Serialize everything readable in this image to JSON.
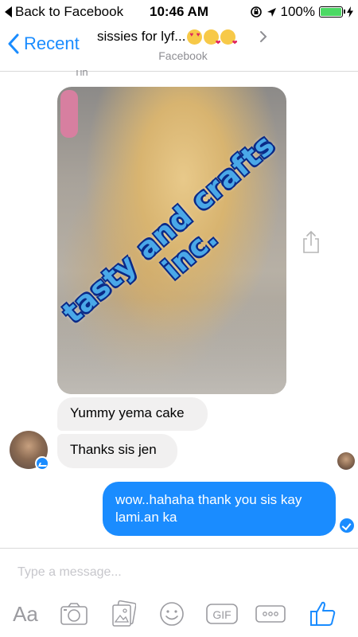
{
  "status_bar": {
    "back_label": "Back to Facebook",
    "time": "10:46 AM",
    "battery": "100%"
  },
  "header": {
    "back_label": "Recent",
    "title": "sissies for lyf...",
    "subtitle": "Facebook"
  },
  "chat": {
    "sender_name_cropped": "Tin",
    "photo_watermark": "tasty and crafts inc.",
    "incoming": [
      {
        "text": "Yummy yema cake"
      },
      {
        "text": "Thanks sis jen"
      }
    ],
    "outgoing": [
      {
        "text": "wow..hahaha thank you sis kay lami.an ka"
      }
    ]
  },
  "composer": {
    "placeholder": "Type a message...",
    "aa_label": "Aa",
    "gif_label": "GIF"
  },
  "colors": {
    "accent": "#1a8cff",
    "incoming_bubble": "#f1f0f0",
    "battery_fill": "#4cd964"
  },
  "icons": [
    "back-triangle-icon",
    "lock-rotation-icon",
    "location-icon",
    "charging-icon",
    "chevron-left-icon",
    "chevron-right-icon",
    "share-icon",
    "camera-icon",
    "gallery-icon",
    "emoji-icon",
    "gif-icon",
    "more-icon",
    "like-icon",
    "messenger-badge-icon",
    "delivered-check-icon"
  ]
}
